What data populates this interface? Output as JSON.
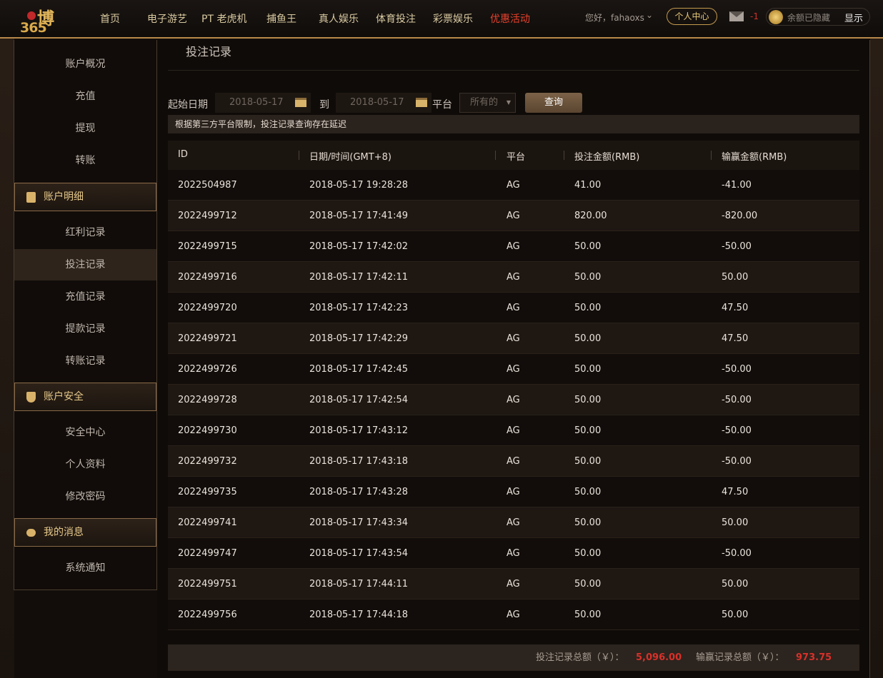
{
  "header": {
    "logo_text": "博365",
    "nav": [
      "首页",
      "电子游艺",
      "PT 老虎机",
      "捕鱼王",
      "真人娱乐",
      "体育投注",
      "彩票娱乐",
      "优惠活动"
    ],
    "greeting": "您好，fahaoxs",
    "personal_center": "个人中心",
    "mail_count": "-1",
    "balance_text": "余额已隐藏",
    "show_label": "显示"
  },
  "sidebar": {
    "top_items": [
      "账户概况",
      "充值",
      "提现",
      "转账"
    ],
    "sections": [
      {
        "title": "账户明细",
        "items": [
          "红利记录",
          "投注记录",
          "充值记录",
          "提款记录",
          "转账记录"
        ]
      },
      {
        "title": "账户安全",
        "items": [
          "安全中心",
          "个人资料",
          "修改密码"
        ]
      },
      {
        "title": "我的消息",
        "items": [
          "系统通知"
        ]
      }
    ]
  },
  "main": {
    "title": "投注记录",
    "filter": {
      "start_label": "起始日期",
      "start_date": "2018-05-17",
      "to_label": "到",
      "end_date": "2018-05-17",
      "platform_label": "平台",
      "platform_value": "所有的",
      "query_label": "查询"
    },
    "notice": "根据第三方平台限制，投注记录查询存在延迟",
    "columns": [
      "ID",
      "日期/时间(GMT+8)",
      "平台",
      "投注金额(RMB)",
      "输赢金额(RMB)"
    ],
    "rows": [
      [
        "2022504987",
        "2018-05-17 19:28:28",
        "AG",
        "41.00",
        "-41.00"
      ],
      [
        "2022499712",
        "2018-05-17 17:41:49",
        "AG",
        "820.00",
        "-820.00"
      ],
      [
        "2022499715",
        "2018-05-17 17:42:02",
        "AG",
        "50.00",
        "-50.00"
      ],
      [
        "2022499716",
        "2018-05-17 17:42:11",
        "AG",
        "50.00",
        "50.00"
      ],
      [
        "2022499720",
        "2018-05-17 17:42:23",
        "AG",
        "50.00",
        "47.50"
      ],
      [
        "2022499721",
        "2018-05-17 17:42:29",
        "AG",
        "50.00",
        "47.50"
      ],
      [
        "2022499726",
        "2018-05-17 17:42:45",
        "AG",
        "50.00",
        "-50.00"
      ],
      [
        "2022499728",
        "2018-05-17 17:42:54",
        "AG",
        "50.00",
        "-50.00"
      ],
      [
        "2022499730",
        "2018-05-17 17:43:12",
        "AG",
        "50.00",
        "-50.00"
      ],
      [
        "2022499732",
        "2018-05-17 17:43:18",
        "AG",
        "50.00",
        "-50.00"
      ],
      [
        "2022499735",
        "2018-05-17 17:43:28",
        "AG",
        "50.00",
        "47.50"
      ],
      [
        "2022499741",
        "2018-05-17 17:43:34",
        "AG",
        "50.00",
        "50.00"
      ],
      [
        "2022499747",
        "2018-05-17 17:43:54",
        "AG",
        "50.00",
        "-50.00"
      ],
      [
        "2022499751",
        "2018-05-17 17:44:11",
        "AG",
        "50.00",
        "50.00"
      ],
      [
        "2022499756",
        "2018-05-17 17:44:18",
        "AG",
        "50.00",
        "50.00"
      ]
    ],
    "footer": {
      "bet_total_label": "投注记录总额（￥）：",
      "bet_total": "5,096.00",
      "win_total_label": "输赢记录总额（￥）：",
      "win_total": "973.75"
    }
  }
}
